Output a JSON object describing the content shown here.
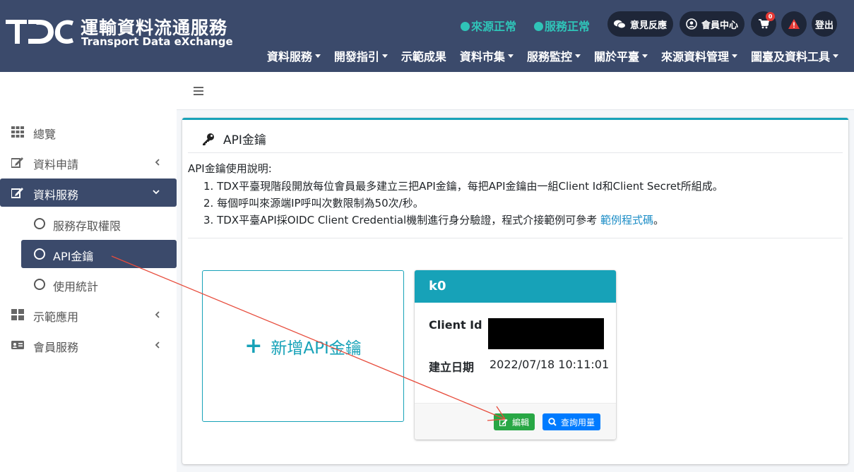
{
  "header": {
    "logo_mark": "TDC",
    "title_zh": "運輸資料流通服務",
    "title_en": "Transport Data eXchange",
    "status_source": "來源正常",
    "status_service": "服務正常",
    "feedback_label": "意見反應",
    "member_label": "會員中心",
    "cart_count": "0",
    "logout_label": "登出",
    "status_color": "#2fc4b8",
    "bg_color": "#3b4a6b"
  },
  "nav": [
    {
      "label": "資料服務",
      "dropdown": true
    },
    {
      "label": "開發指引",
      "dropdown": true
    },
    {
      "label": "示範成果",
      "dropdown": false
    },
    {
      "label": "資料市集",
      "dropdown": true
    },
    {
      "label": "服務監控",
      "dropdown": true
    },
    {
      "label": "關於平臺",
      "dropdown": true
    },
    {
      "label": "來源資料管理",
      "dropdown": true
    },
    {
      "label": "圖臺及資料工具",
      "dropdown": true
    }
  ],
  "sidebar": {
    "items": [
      {
        "label": "總覽",
        "icon": "grid-icon"
      },
      {
        "label": "資料申請",
        "icon": "edit-icon"
      },
      {
        "label": "資料服務",
        "icon": "edit-icon"
      },
      {
        "label": "示範應用",
        "icon": "tiles-icon"
      },
      {
        "label": "會員服務",
        "icon": "id-card-icon"
      }
    ],
    "subitems": [
      {
        "label": "服務存取權限"
      },
      {
        "label": "API金鑰"
      },
      {
        "label": "使用統計"
      }
    ]
  },
  "content": {
    "title": "API金鑰",
    "desc_title": "API金鑰使用說明:",
    "desc": {
      "line1": "1. TDX平臺現階段開放每位會員最多建立三把API金鑰，每把API金鑰由一組Client Id和Client Secret所組成。",
      "line2": "2. 每個呼叫來源端IP呼叫次數限制為50次/秒。",
      "line3_prefix": "3. TDX平臺API採OIDC Client Credential機制進行身分驗證，程式介接範例可參考 ",
      "line3_link": "範例程式碼",
      "line3_suffix": "。"
    },
    "add_key_label": "新增API金鑰",
    "key_card": {
      "name": "k0",
      "client_id_label": "Client Id",
      "created_label": "建立日期",
      "created_value": "2022/07/18 10:11:01",
      "edit_label": "編輯",
      "usage_label": "查詢用量"
    },
    "accent_color": "#17a2b8"
  }
}
